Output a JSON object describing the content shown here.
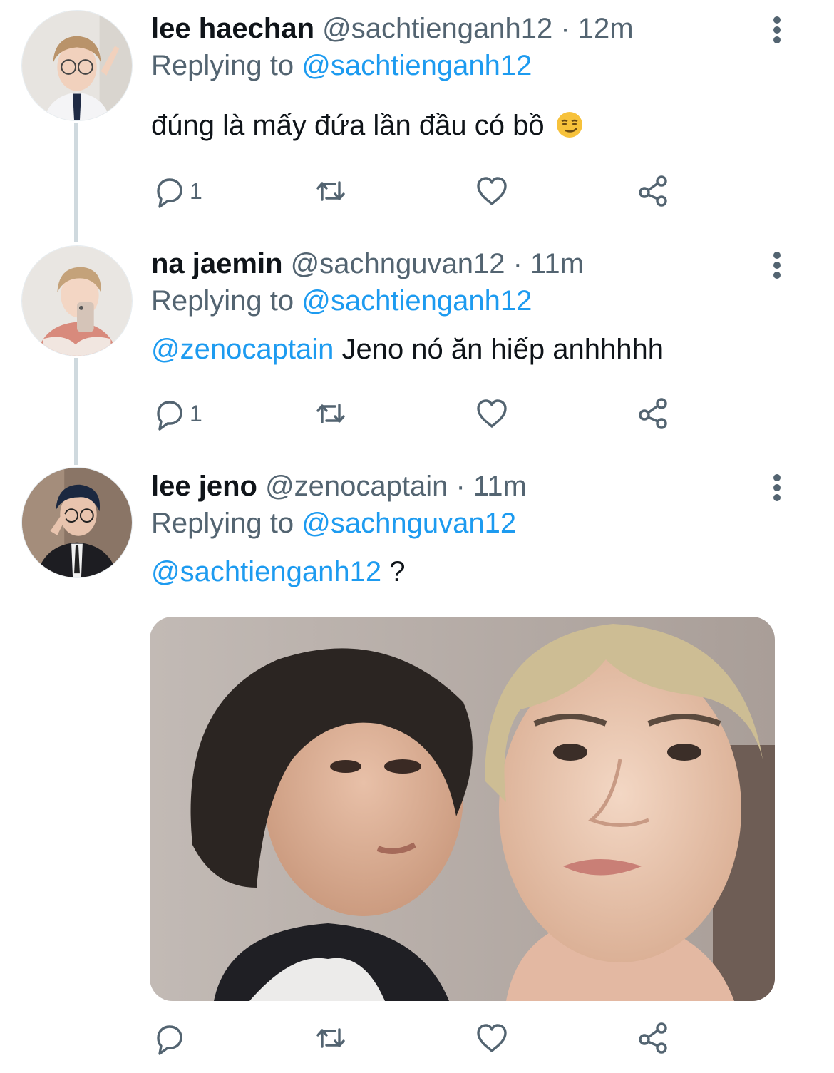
{
  "replying_prefix": "Replying to",
  "tweets": [
    {
      "name": "lee haechan",
      "handle": "@sachtienganh12",
      "sep": "·",
      "time": "12m",
      "replying_to": "@sachtienganh12",
      "mention": "",
      "text": "đúng là mấy đứa lần đầu có bồ",
      "emoji": "smirking-face",
      "reply_count": "1"
    },
    {
      "name": "na jaemin",
      "handle": "@sachnguvan12",
      "sep": "·",
      "time": "11m",
      "replying_to": "@sachtienganh12",
      "mention": "@zenocaptain",
      "text": "Jeno nó ăn hiếp anhhhhh",
      "reply_count": "1"
    },
    {
      "name": "lee jeno",
      "handle": "@zenocaptain",
      "sep": "·",
      "time": "11m",
      "replying_to": "@sachnguvan12",
      "mention": "@sachtienganh12",
      "text": "?",
      "reply_count": "",
      "media": "photo"
    }
  ],
  "icons": {
    "reply": "reply-icon",
    "retweet": "retweet-icon",
    "like": "heart-icon",
    "share": "share-icon",
    "more": "more-vertical-icon"
  },
  "colors": {
    "link": "#1d9bf0",
    "secondary_text": "#536471",
    "thread_line": "#cfd9de"
  }
}
